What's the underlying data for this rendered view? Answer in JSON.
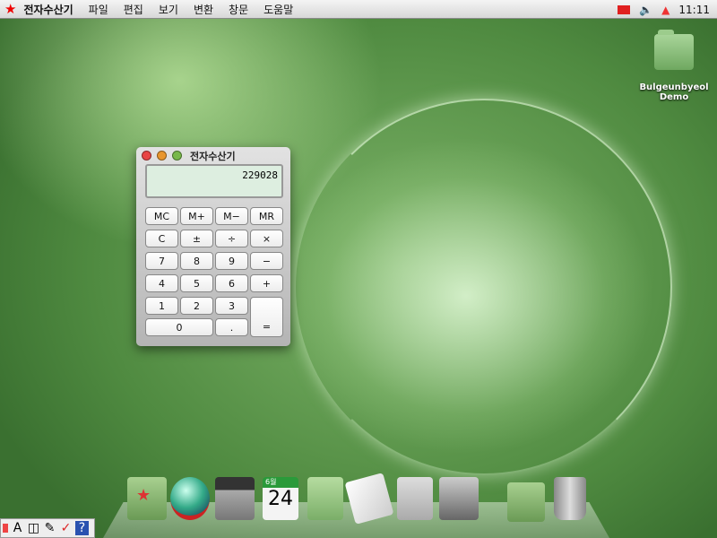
{
  "menubar": {
    "app": "전자수산기",
    "items": [
      "파일",
      "편집",
      "보기",
      "변환",
      "창문",
      "도움말"
    ],
    "clock": "11:11"
  },
  "desktop": {
    "icon_label": "Bulgeunbyeol Demo"
  },
  "calculator": {
    "title": "전자수산기",
    "display": "229028",
    "buttons": [
      "MC",
      "M+",
      "M−",
      "MR",
      "C",
      "±",
      "÷",
      "×",
      "7",
      "8",
      "9",
      "−",
      "4",
      "5",
      "6",
      "+",
      "1",
      "2",
      "3",
      "0",
      ".",
      "="
    ]
  },
  "dock": {
    "calendar_month": "6월",
    "calendar_day": "24"
  },
  "toolbox": {
    "items": [
      "A",
      "◫",
      "✎",
      "✓",
      "?"
    ]
  }
}
